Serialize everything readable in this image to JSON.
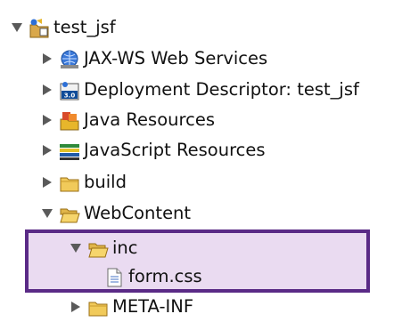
{
  "tree": {
    "project": {
      "label": "test_jsf",
      "icon": "project-icon",
      "expanded": true
    },
    "items": [
      {
        "label": "JAX-WS Web Services",
        "icon": "web-services-icon",
        "expanded": false
      },
      {
        "label": "Deployment Descriptor: test_jsf",
        "icon": "deployment-descriptor-icon",
        "expanded": false
      },
      {
        "label": "Java Resources",
        "icon": "java-resources-icon",
        "expanded": false
      },
      {
        "label": "JavaScript Resources",
        "icon": "javascript-resources-icon",
        "expanded": false
      },
      {
        "label": "build",
        "icon": "folder-icon",
        "expanded": false
      },
      {
        "label": "WebContent",
        "icon": "folder-open-icon",
        "expanded": true
      },
      {
        "label": "inc",
        "icon": "folder-open-icon",
        "expanded": true,
        "highlighted": true
      },
      {
        "label": "form.css",
        "icon": "file-icon",
        "highlighted": true
      },
      {
        "label": "META-INF",
        "icon": "folder-icon",
        "expanded": false
      }
    ]
  },
  "colors": {
    "highlight_fill": "#eadbf1",
    "highlight_border": "#5a2a86"
  }
}
